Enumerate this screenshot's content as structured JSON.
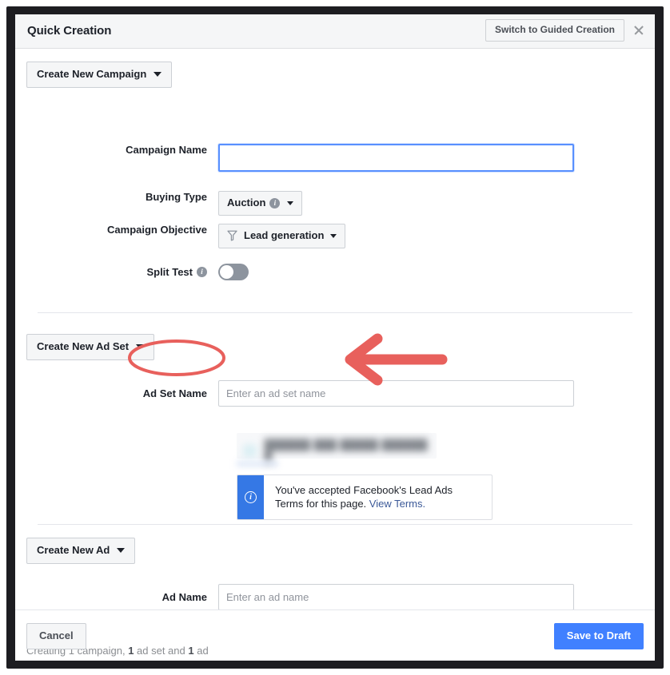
{
  "window": {
    "title": "Quick Creation",
    "switch_button": "Switch to Guided Creation",
    "close_icon": "close-icon"
  },
  "campaign_section": {
    "selector_label": "Create New Campaign",
    "fields": {
      "campaign_name": {
        "label": "Campaign Name",
        "value": "",
        "placeholder": "",
        "focused": true
      },
      "buying_type": {
        "label": "Buying Type",
        "value": "Auction",
        "has_info_icon": true
      },
      "campaign_objective": {
        "label": "Campaign Objective",
        "value": "Lead generation",
        "icon": "funnel-icon"
      },
      "split_test": {
        "label": "Split Test",
        "has_info_icon": true,
        "enabled": false
      }
    }
  },
  "adset_section": {
    "selector_label": "Create New Ad Set",
    "fields": {
      "adset_name": {
        "label": "Ad Set Name",
        "value": "",
        "placeholder": "Enter an ad set name"
      },
      "page_selector": {
        "label": "",
        "blurred": true,
        "redacted_text": "██████ ███ █████ ██████ █"
      }
    },
    "terms_notice": {
      "icon": "info-icon",
      "text": "You've accepted Facebook's Lead Ads Terms for this page. ",
      "link_text": "View Terms."
    }
  },
  "ad_section": {
    "selector_label": "Create New Ad",
    "fields": {
      "ad_name": {
        "label": "Ad Name",
        "value": "",
        "placeholder": "Enter an ad name"
      }
    }
  },
  "summary": {
    "prefix": "Creating 1 campaign, ",
    "bold_1": "1",
    "mid": " ad set and ",
    "bold_2": "1",
    "suffix": " ad"
  },
  "footer": {
    "cancel_label": "Cancel",
    "save_label": "Save to Draft"
  },
  "annotations": {
    "ellipse": {
      "target": "Ad Set Name label",
      "color": "#e8605c"
    },
    "arrow": {
      "target": "Ad Set Name input",
      "direction": "left",
      "color": "#e8605c"
    }
  },
  "colors": {
    "accent_blue": "#4080ff",
    "info_blue": "#3578e5",
    "annotation_red": "#e8605c",
    "header_bg": "#f5f6f7",
    "frame": "#1d1d21"
  }
}
